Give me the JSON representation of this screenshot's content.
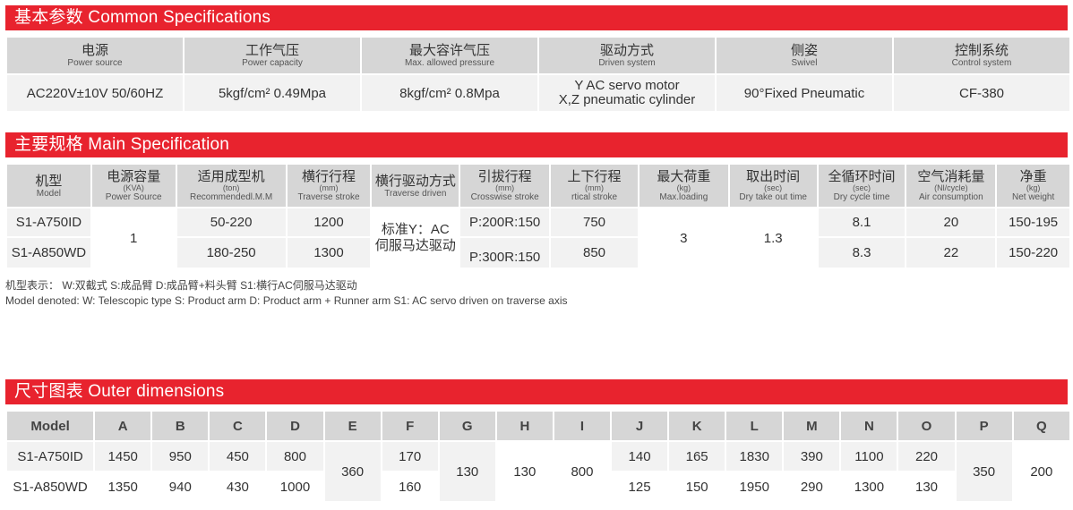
{
  "common": {
    "title": "基本参数 Common Specifications",
    "headers": [
      {
        "cn": "电源",
        "en": "Power source"
      },
      {
        "cn": "工作气压",
        "en": "Power capacity"
      },
      {
        "cn": "最大容许气压",
        "en": "Max. allowed pressure"
      },
      {
        "cn": "驱动方式",
        "en": "Driven system"
      },
      {
        "cn": "侧姿",
        "en": "Swivel"
      },
      {
        "cn": "控制系统",
        "en": "Control system"
      }
    ],
    "values": [
      "AC220V±10V 50/60HZ",
      "5kgf/cm² 0.49Mpa",
      "8kgf/cm² 0.8Mpa",
      "Y AC servo motor",
      "90°Fixed Pneumatic",
      "CF-380"
    ],
    "driven_line2": "X,Z pneumatic cylinder"
  },
  "main": {
    "title": "主要规格 Main Specification",
    "headers": [
      {
        "cn": "机型",
        "unit": "",
        "en": "Model"
      },
      {
        "cn": "电源容量",
        "unit": "(KVA)",
        "en": "Power Source"
      },
      {
        "cn": "适用成型机",
        "unit": "(ton)",
        "en": "Recommendedl.M.M"
      },
      {
        "cn": "横行行程",
        "unit": "(mm)",
        "en": "Traverse stroke"
      },
      {
        "cn": "横行驱动方式",
        "unit": "",
        "en": "Traverse driven"
      },
      {
        "cn": "引拔行程",
        "unit": "(mm)",
        "en": "Crosswise stroke"
      },
      {
        "cn": "上下行程",
        "unit": "(mm)",
        "en": "rtical stroke"
      },
      {
        "cn": "最大荷重",
        "unit": "(kg)",
        "en": "Max.loading"
      },
      {
        "cn": "取出时间",
        "unit": "(sec)",
        "en": "Dry take out time"
      },
      {
        "cn": "全循环时间",
        "unit": "(sec)",
        "en": "Dry cycle time"
      },
      {
        "cn": "空气消耗量",
        "unit": "(Nl/cycle)",
        "en": "Air consumption"
      },
      {
        "cn": "净重",
        "unit": "(kg)",
        "en": "Net weight"
      }
    ],
    "rows": [
      {
        "model": "S1-A750ID",
        "imm": "50-220",
        "traverse": "1200",
        "crosswise": "P:200R:150",
        "vertical": "750",
        "cycle": "8.1",
        "air": "20",
        "weight": "150-195"
      },
      {
        "model": "S1-A850WD",
        "imm": "180-250",
        "traverse": "1300",
        "crosswise": "P:300R:150",
        "vertical": "850",
        "cycle": "8.3",
        "air": "22",
        "weight": "150-220"
      }
    ],
    "power": "1",
    "traverse_driven_line1": "标准Y：AC",
    "traverse_driven_line2": "伺服马达驱动",
    "max_loading": "3",
    "take_out": "1.3"
  },
  "notes": {
    "cn": "机型表示： W:双截式 S:成品臂 D:成品臂+料头臂 S1:横行AC伺服马达驱动",
    "en": "Model denoted:  W: Telescopic type  S: Product arm  D: Product arm + Runner arm  S1: AC servo driven on traverse axis"
  },
  "outer": {
    "title": "尺寸图表 Outer dimensions",
    "headers": [
      "Model",
      "A",
      "B",
      "C",
      "D",
      "E",
      "F",
      "G",
      "H",
      "I",
      "J",
      "K",
      "L",
      "M",
      "N",
      "O",
      "P",
      "Q"
    ],
    "rows": [
      {
        "model": "S1-A750ID",
        "A": "1450",
        "B": "950",
        "C": "450",
        "D": "800",
        "F": "170",
        "J": "140",
        "K": "165",
        "L": "1830",
        "M": "390",
        "N": "1100",
        "O": "220"
      },
      {
        "model": "S1-A850WD",
        "A": "1350",
        "B": "940",
        "C": "430",
        "D": "1000",
        "F": "160",
        "J": "125",
        "K": "150",
        "L": "1950",
        "M": "290",
        "N": "1300",
        "O": "130"
      }
    ],
    "merged": {
      "E": "360",
      "G": "130",
      "H": "130",
      "I": "800",
      "P": "350",
      "Q": "200"
    }
  }
}
